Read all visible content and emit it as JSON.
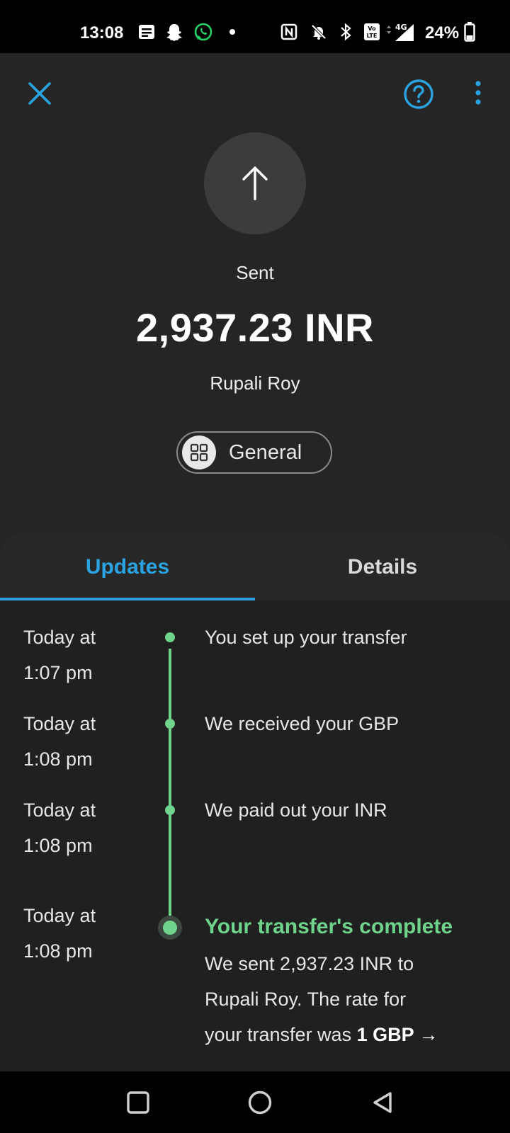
{
  "status_bar": {
    "time": "13:08",
    "battery": "24%",
    "network": "4G",
    "icons": [
      "notes-icon",
      "snapchat-icon",
      "whatsapp-icon",
      "dot-icon",
      "nfc-icon",
      "mute-icon",
      "bluetooth-icon",
      "volte-icon",
      "signal-icon",
      "battery-icon"
    ]
  },
  "header": {
    "close_icon": "close-icon",
    "help_icon": "help-icon",
    "more_icon": "more-icon"
  },
  "transfer": {
    "direction_icon": "arrow-up-icon",
    "status": "Sent",
    "amount": "2,937.23 INR",
    "recipient": "Rupali Roy",
    "category": "General"
  },
  "tabs": [
    {
      "label": "Updates",
      "active": true
    },
    {
      "label": "Details",
      "active": false
    }
  ],
  "updates": [
    {
      "time_line1": "Today at",
      "time_line2": "1:07 pm",
      "text": "You set up your transfer"
    },
    {
      "time_line1": "Today at",
      "time_line2": "1:08 pm",
      "text": "We received your GBP"
    },
    {
      "time_line1": "Today at",
      "time_line2": "1:08 pm",
      "text": "We paid out your INR"
    },
    {
      "time_line1": "Today at",
      "time_line2": "1:08 pm",
      "title": "Your transfer's complete",
      "desc_line1": "We sent 2,937.23 INR to",
      "desc_line2": "Rupali Roy. The rate for",
      "desc_line3_prefix": "your transfer was ",
      "desc_line3_bold": "1 GBP →"
    }
  ],
  "colors": {
    "accent": "#2aa3e0",
    "success": "#6fd38b",
    "background": "#252525"
  }
}
